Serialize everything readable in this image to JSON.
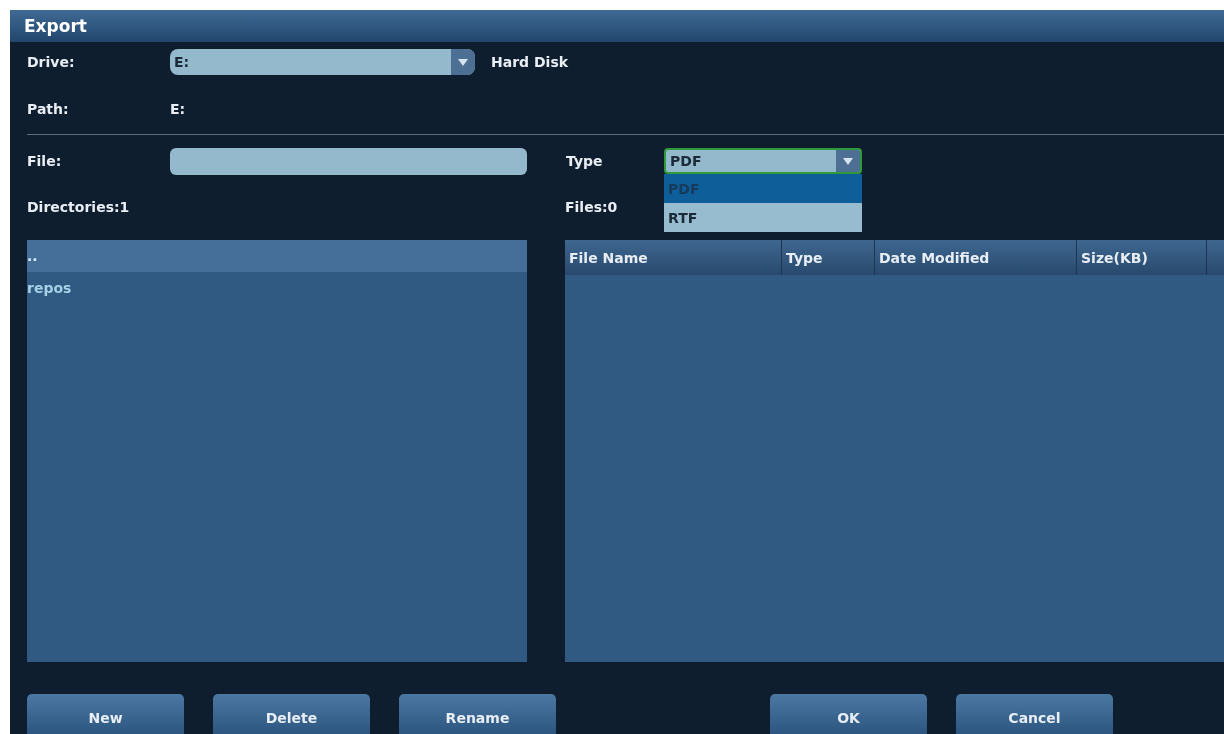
{
  "window": {
    "title": "Export"
  },
  "drive": {
    "label": "Drive:",
    "value": "E:",
    "description": "Hard Disk"
  },
  "path": {
    "label": "Path:",
    "value": "E:"
  },
  "file": {
    "label": "File:"
  },
  "type": {
    "label": "Type",
    "value": "PDF",
    "expanded": true,
    "options": [
      {
        "label": "PDF",
        "selected": true
      },
      {
        "label": "RTF",
        "selected": false
      }
    ]
  },
  "directories": {
    "label": "Directories:1",
    "items": [
      {
        "label": "..",
        "selected": true
      },
      {
        "label": "repos",
        "selected": false
      }
    ]
  },
  "files": {
    "label": "Files:0",
    "columns": [
      "File Name",
      "Type",
      "Date Modified",
      "Size(KB)"
    ]
  },
  "left_buttons": [
    "New",
    "Delete",
    "Rename"
  ],
  "right_buttons": [
    "OK",
    "Cancel"
  ]
}
